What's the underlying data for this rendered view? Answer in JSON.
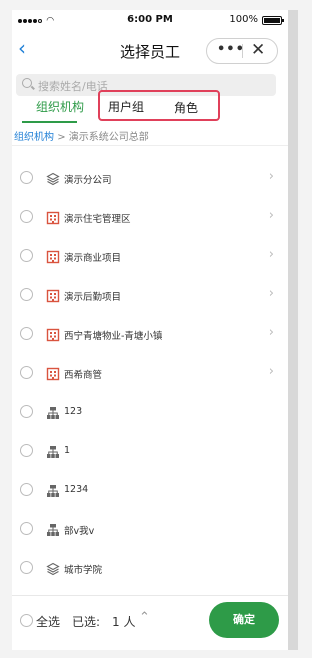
{
  "status_bar": {
    "time": "6:00 PM",
    "battery": "100%"
  },
  "nav": {
    "title": "选择员工"
  },
  "search": {
    "placeholder": "搜索姓名/电话"
  },
  "tabs": [
    {
      "label": "组织机构",
      "active": true
    },
    {
      "label": "用户组",
      "active": false
    },
    {
      "label": "角色",
      "active": false
    }
  ],
  "breadcrumb": {
    "root": "组织机构",
    "separator": ">",
    "current": "演示系统公司总部"
  },
  "list": [
    {
      "label": "演示分公司",
      "icon": "layers-icon",
      "chevron": true
    },
    {
      "label": "演示住宅管理区",
      "icon": "building-icon",
      "chevron": true
    },
    {
      "label": "演示商业项目",
      "icon": "building-icon",
      "chevron": true
    },
    {
      "label": "演示后勤项目",
      "icon": "building-icon",
      "chevron": true
    },
    {
      "label": "西宁青塘物业-青塘小镇",
      "icon": "building-icon",
      "chevron": true
    },
    {
      "label": "西希商管",
      "icon": "building-icon",
      "chevron": true
    },
    {
      "label": "123",
      "icon": "org-chart-icon",
      "chevron": false
    },
    {
      "label": "1",
      "icon": "org-chart-icon",
      "chevron": false
    },
    {
      "label": "1234",
      "icon": "org-chart-icon",
      "chevron": false
    },
    {
      "label": "部v我v",
      "icon": "org-chart-icon",
      "chevron": false
    },
    {
      "label": "城市学院",
      "icon": "layers-icon",
      "chevron": false
    }
  ],
  "bottom": {
    "select_all": "全选",
    "selected_label": "已选:",
    "selected_count": "1 人",
    "confirm": "确定"
  },
  "colors": {
    "accent_green": "#2e9b48",
    "link_blue": "#1f7fd6",
    "highlight_red": "#e0405a",
    "building_icon_red": "#d9543f"
  }
}
